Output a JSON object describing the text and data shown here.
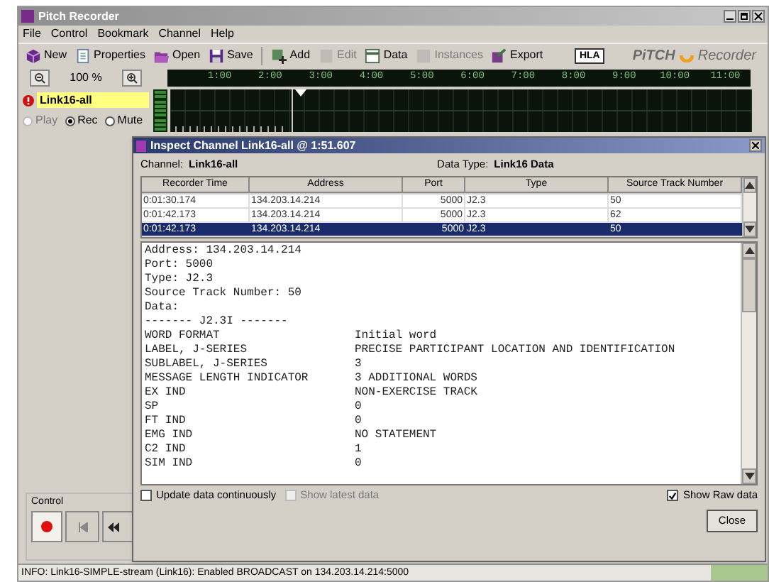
{
  "window": {
    "title": "Pitch Recorder"
  },
  "menu": [
    "File",
    "Control",
    "Bookmark",
    "Channel",
    "Help"
  ],
  "toolbar": [
    {
      "label": "New",
      "kind": "cube",
      "disabled": false
    },
    {
      "label": "Properties",
      "kind": "page",
      "disabled": false
    },
    {
      "label": "Open",
      "kind": "folder",
      "disabled": false
    },
    {
      "label": "Save",
      "kind": "disk",
      "disabled": false
    },
    {
      "label": "Add",
      "kind": "add",
      "disabled": false
    },
    {
      "label": "Edit",
      "kind": "edit",
      "disabled": true
    },
    {
      "label": "Data",
      "kind": "data",
      "disabled": false
    },
    {
      "label": "Instances",
      "kind": "instances",
      "disabled": true
    },
    {
      "label": "Export",
      "kind": "export",
      "disabled": false
    }
  ],
  "branding": {
    "badge": "HLA",
    "name": "PiTCH",
    "product": "Recorder"
  },
  "zoom": {
    "label": "100 %"
  },
  "timeline": {
    "ticks": [
      "1:00",
      "2:00",
      "3:00",
      "4:00",
      "5:00",
      "6:00",
      "7:00",
      "8:00",
      "9:00",
      "10:00",
      "11:00"
    ],
    "level": 0.215
  },
  "channel": {
    "name": "Link16-all",
    "error": true,
    "modes": [
      {
        "label": "Play",
        "selected": false,
        "disabled": true
      },
      {
        "label": "Rec",
        "selected": true,
        "disabled": false
      },
      {
        "label": "Mute",
        "selected": false,
        "disabled": false
      }
    ]
  },
  "control": {
    "title": "Control"
  },
  "status_bar": {
    "text": "INFO: Link16-SIMPLE-stream (Link16): Enabled BROADCAST on 134.203.14.214:5000"
  },
  "dialog": {
    "title": "Inspect Channel Link16-all @ 1:51.607",
    "channel_label": "Channel:",
    "channel": "Link16-all",
    "data_type_label": "Data Type:",
    "data_type": "Link16 Data",
    "columns": [
      "Recorder Time",
      "Address",
      "Port",
      "Type",
      "Source Track Number"
    ],
    "rows": [
      {
        "cells": [
          "0:01:30.174",
          "134.203.14.214",
          "5000",
          "J2.3",
          "50"
        ],
        "selected": false
      },
      {
        "cells": [
          "0:01:42.173",
          "134.203.14.214",
          "5000",
          "J2.3",
          "62"
        ],
        "selected": false
      },
      {
        "cells": [
          "0:01:42.173",
          "134.203.14.214",
          "5000",
          "J2.3",
          "50"
        ],
        "selected": true
      }
    ],
    "raw_lines": [
      "Address: 134.203.14.214",
      "Port: 5000",
      "Type: J2.3",
      "Source Track Number: 50",
      "Data:",
      "------- J2.3I -------"
    ],
    "fields": [
      [
        "WORD FORMAT",
        "Initial word"
      ],
      [
        "LABEL, J-SERIES",
        "PRECISE PARTICIPANT LOCATION AND IDENTIFICATION"
      ],
      [
        "SUBLABEL, J-SERIES",
        "3"
      ],
      [
        "MESSAGE LENGTH INDICATOR",
        "3 ADDITIONAL WORDS"
      ],
      [
        "EX IND",
        "NON-EXERCISE TRACK"
      ],
      [
        "SP",
        "0"
      ],
      [
        "FT IND",
        "0"
      ],
      [
        "EMG IND",
        "NO STATEMENT"
      ],
      [
        "C2 IND",
        "1"
      ],
      [
        "SIM IND",
        "0"
      ]
    ],
    "options": [
      {
        "label": "Update data continuously",
        "checked": false,
        "disabled": false
      },
      {
        "label": "Show latest data",
        "checked": false,
        "disabled": true
      }
    ],
    "raw_option": {
      "label": "Show Raw data",
      "checked": true
    },
    "close": "Close"
  }
}
